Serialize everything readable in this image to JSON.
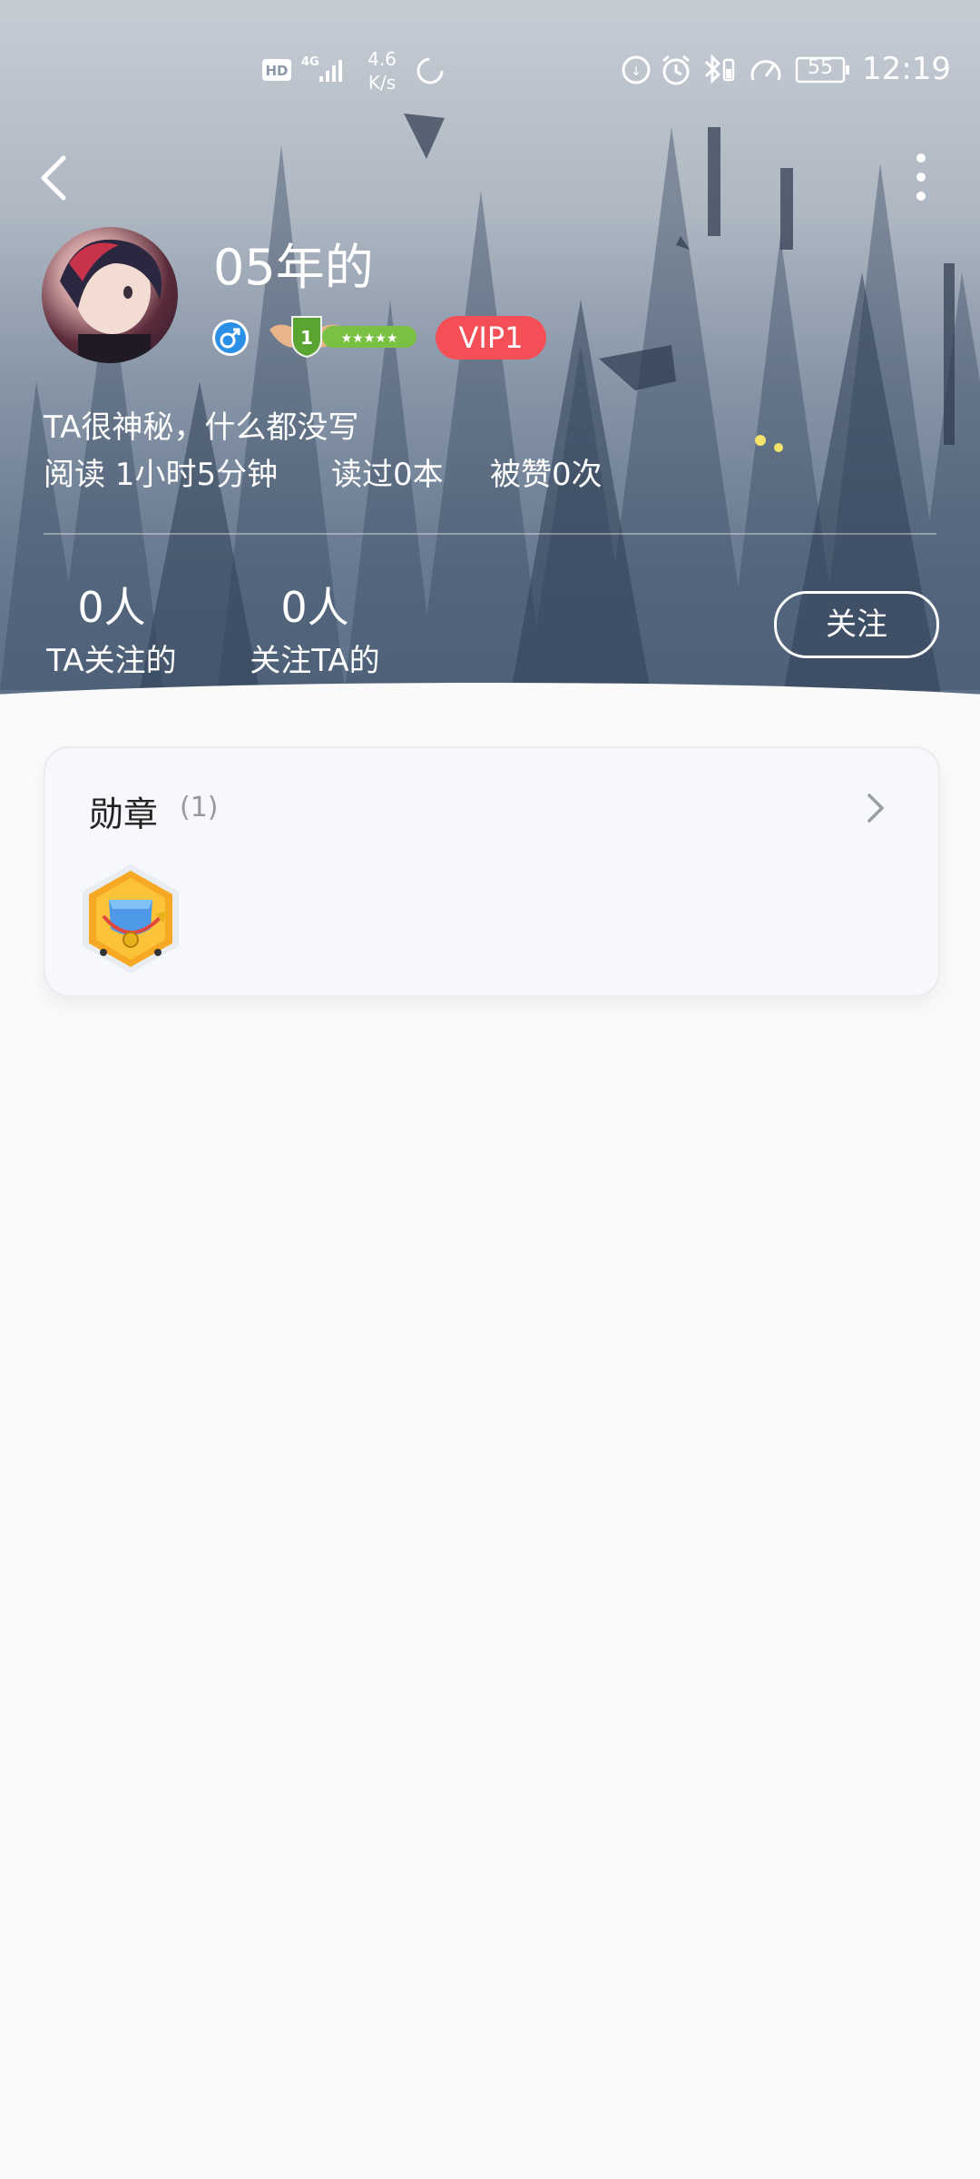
{
  "status_bar": {
    "net_speed_value": "4.6",
    "net_speed_unit": "K/s",
    "battery": "55",
    "time": "12:19",
    "icons": [
      "hd-icon",
      "4g-signal-icon",
      "loading-circle-icon",
      "data-saver-icon",
      "alarm-icon",
      "bluetooth-icon",
      "speed-icon",
      "battery-icon"
    ]
  },
  "profile": {
    "username": "05年的",
    "gender": "male",
    "level": "1",
    "vip_label": "VIP1",
    "bio": "TA很神秘，什么都没写",
    "stats": {
      "reading": "阅读 1小时5分钟",
      "books_read": "读过0本",
      "likes": "被赞0次"
    },
    "following": {
      "count": "0人",
      "label": "TA关注的"
    },
    "followers": {
      "count": "0人",
      "label": "关注TA的"
    },
    "follow_button": "关注"
  },
  "medals": {
    "title": "勋章",
    "count": "(1)"
  },
  "colors": {
    "vip_red": "#f44f57",
    "page_bg": "#fafafb",
    "card_bg": "#f7f8fb",
    "level_green": "#7ac143"
  }
}
